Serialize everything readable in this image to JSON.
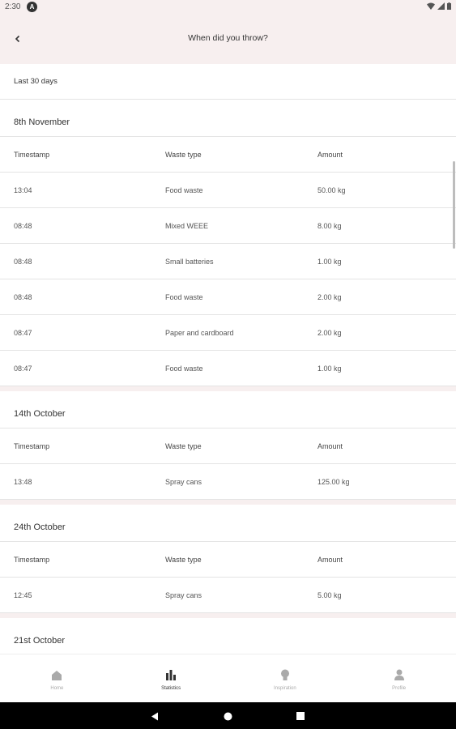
{
  "status_bar": {
    "time": "2:30",
    "badge": "A"
  },
  "app_bar": {
    "title": "When did you throw?"
  },
  "filter": {
    "label": "Last 30 days"
  },
  "columns": {
    "timestamp": "Timestamp",
    "waste_type": "Waste type",
    "amount": "Amount"
  },
  "sections": [
    {
      "date": "8th November",
      "rows": [
        {
          "time": "13:04",
          "type": "Food waste",
          "amount": "50.00 kg"
        },
        {
          "time": "08:48",
          "type": "Mixed WEEE",
          "amount": "8.00 kg"
        },
        {
          "time": "08:48",
          "type": "Small batteries",
          "amount": "1.00 kg"
        },
        {
          "time": "08:48",
          "type": "Food waste",
          "amount": "2.00 kg"
        },
        {
          "time": "08:47",
          "type": "Paper and cardboard",
          "amount": "2.00 kg"
        },
        {
          "time": "08:47",
          "type": "Food waste",
          "amount": "1.00 kg"
        }
      ]
    },
    {
      "date": "14th October",
      "rows": [
        {
          "time": "13:48",
          "type": "Spray cans",
          "amount": "125.00 kg"
        }
      ]
    },
    {
      "date": "24th October",
      "rows": [
        {
          "time": "12:45",
          "type": "Spray cans",
          "amount": "5.00 kg"
        }
      ]
    },
    {
      "date": "21st October",
      "rows": []
    }
  ],
  "bottom_nav": [
    {
      "label": "Home",
      "icon": "home-icon",
      "active": false
    },
    {
      "label": "Statistics",
      "icon": "bar-chart-icon",
      "active": true
    },
    {
      "label": "Inspiration",
      "icon": "lightbulb-icon",
      "active": false
    },
    {
      "label": "Profile",
      "icon": "person-icon",
      "active": false
    }
  ],
  "colors": {
    "app_bar_bg": "#f7efef",
    "divider": "#e4e4e4",
    "nav_active": "#333333",
    "nav_inactive": "#aaaaaa"
  }
}
